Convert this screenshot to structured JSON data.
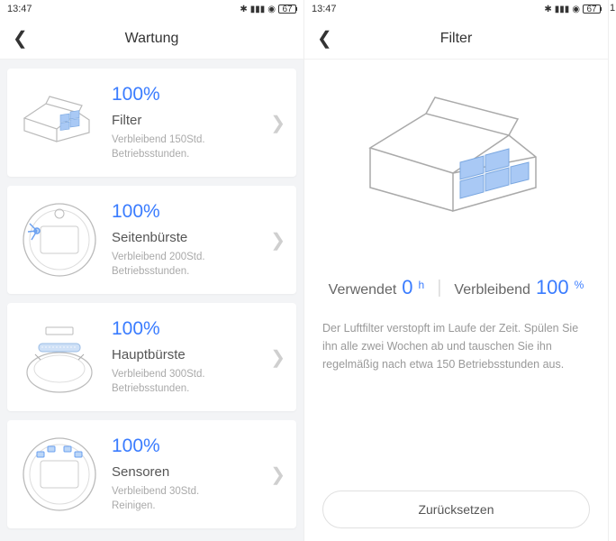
{
  "statusbar": {
    "time": "13:47",
    "battery": "67"
  },
  "screen1": {
    "title": "Wartung",
    "items": [
      {
        "percent": "100%",
        "title": "Filter",
        "line1": "Verbleibend 150Std.",
        "line2": "Betriebsstunden."
      },
      {
        "percent": "100%",
        "title": "Seitenbürste",
        "line1": "Verbleibend 200Std.",
        "line2": "Betriebsstunden."
      },
      {
        "percent": "100%",
        "title": "Hauptbürste",
        "line1": "Verbleibend 300Std.",
        "line2": "Betriebsstunden."
      },
      {
        "percent": "100%",
        "title": "Sensoren",
        "line1": "Verbleibend 30Std.",
        "line2": "Reinigen."
      }
    ]
  },
  "screen2": {
    "title": "Filter",
    "usedLabel": "Verwendet",
    "usedValue": "0",
    "usedUnit": "h",
    "remainingLabel": "Verbleibend",
    "remainingValue": "100",
    "remainingUnit": "%",
    "description": "Der Luftfilter verstopft im Laufe der Zeit. Spülen Sie ihn alle zwei Wochen ab und tauschen Sie ihn regelmäßig nach etwa 150 Betriebsstunden aus.",
    "resetLabel": "Zurücksetzen"
  },
  "edgeTime": "1"
}
